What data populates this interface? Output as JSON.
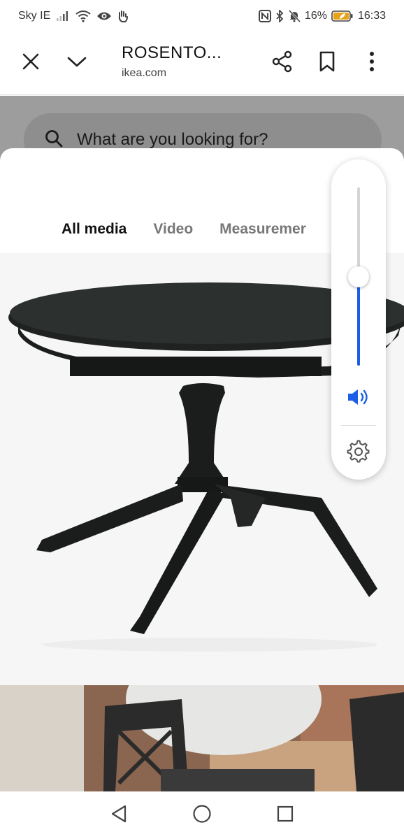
{
  "status_bar": {
    "carrier": "Sky IE",
    "battery_percent": "16%",
    "time": "16:33",
    "icons": [
      "signal-icon",
      "wifi-icon",
      "eye-icon",
      "hand-icon",
      "nfc-icon",
      "bluetooth-icon",
      "mute-icon",
      "battery-icon"
    ]
  },
  "browser": {
    "title": "ROSENTO...",
    "url": "ikea.com",
    "icons": [
      "close-icon",
      "chevron-down-icon",
      "share-icon",
      "bookmark-icon",
      "more-vert-icon"
    ]
  },
  "page": {
    "search_placeholder": "What are you looking for?"
  },
  "media_modal": {
    "tabs": [
      {
        "label": "All media",
        "active": true
      },
      {
        "label": "Video",
        "active": false
      },
      {
        "label": "Measuremer",
        "active": false
      }
    ],
    "close_icon": "close-icon"
  },
  "volume_panel": {
    "level": 0.5,
    "accent": "#1c5fe6",
    "icons": [
      "speaker-icon",
      "gear-icon"
    ]
  },
  "nav_bar": {
    "icons": [
      "back-icon",
      "home-icon",
      "recents-icon"
    ]
  }
}
